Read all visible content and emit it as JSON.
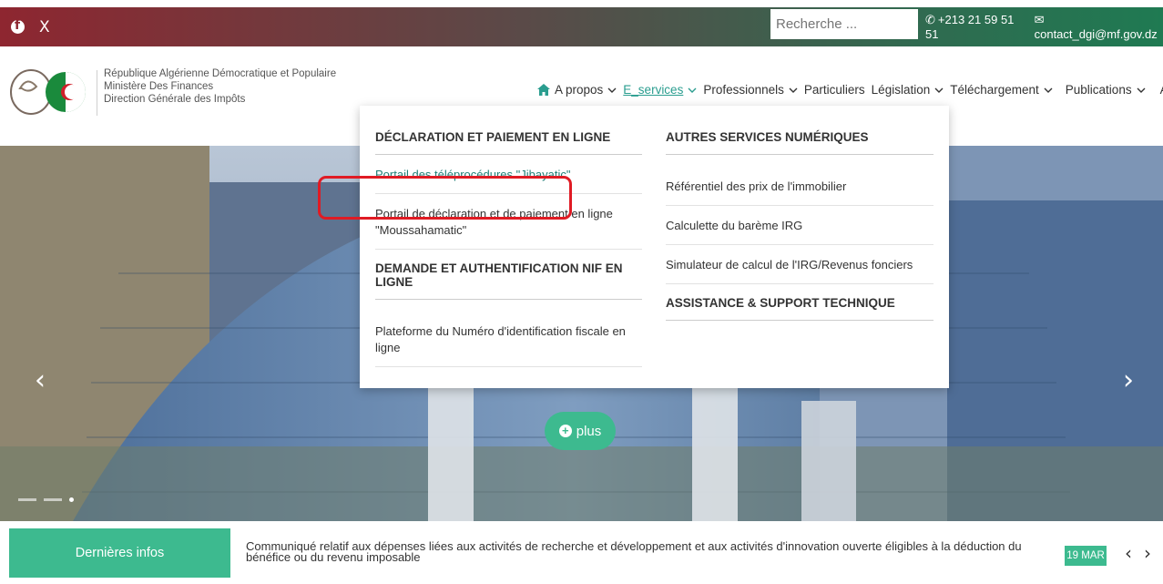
{
  "topbar": {
    "social": {
      "facebook_icon": "facebook-icon",
      "x_label": "X"
    },
    "search": {
      "placeholder": "Recherche ..."
    },
    "contact": {
      "phone": "+213 21 59 51 51",
      "email": "contact_dgi@mf.gov.dz"
    }
  },
  "header": {
    "org_lines": [
      "République Algérienne Démocratique et Populaire",
      "Ministère Des Finances",
      "Direction Générale des Impôts"
    ]
  },
  "nav": {
    "items": [
      {
        "label": "A propos",
        "dropdown": true
      },
      {
        "label": "E_services",
        "dropdown": true,
        "active": true
      },
      {
        "label": "Professionnels",
        "dropdown": true
      },
      {
        "label": "Particuliers",
        "dropdown": false
      },
      {
        "label": "Législation",
        "dropdown": true
      },
      {
        "label": "Téléchargement",
        "dropdown": true
      },
      {
        "label": "Publications",
        "dropdown": true
      },
      {
        "label": "AR",
        "dropdown": false
      }
    ]
  },
  "dropdown": {
    "left": {
      "heading1": "DÉCLARATION ET PAIEMENT EN LIGNE",
      "links1": [
        "Portail des téléprocédures \"Jibayatic\"",
        "Portail de déclaration et de paiement en ligne \"Moussahamatic\""
      ],
      "heading2": "DEMANDE ET AUTHENTIFICATION NIF EN LIGNE",
      "links2": [
        "Plateforme du Numéro d'identification fiscale en ligne"
      ]
    },
    "right": {
      "heading1": "AUTRES SERVICES NUMÉRIQUES",
      "links1": [
        "Référentiel des prix de l'immobilier",
        "Calculette du barème IRG",
        "Simulateur de calcul de l'IRG/Revenus fonciers"
      ],
      "heading2": "ASSISTANCE & SUPPORT TECHNIQUE"
    }
  },
  "hero": {
    "plus_label": "plus",
    "prev": "‹",
    "next": "›"
  },
  "news": {
    "label": "Dernières infos",
    "text": "Communiqué relatif aux dépenses liées aux activités de recherche et développement et aux activités d'innovation ouverte éligibles à la déduction du bénéfice ou du revenu imposable",
    "date": "19 MAR",
    "prev": "‹",
    "next": "›"
  },
  "colors": {
    "accent": "#3dba8f",
    "highlight_frame": "#e01b24",
    "link_teal": "#1f7f77"
  }
}
